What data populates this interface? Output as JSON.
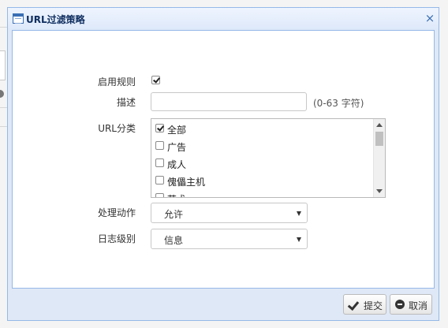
{
  "dialog": {
    "title": "URL过滤策略",
    "close_glyph": "×"
  },
  "form": {
    "enable_rule": {
      "label": "启用规则",
      "checked": true
    },
    "description": {
      "label": "描述",
      "value": "",
      "hint": "(0-63 字符)"
    },
    "url_category": {
      "label": "URL分类",
      "items": [
        {
          "label": "全部",
          "checked": true
        },
        {
          "label": "广告",
          "checked": false
        },
        {
          "label": "成人",
          "checked": false
        },
        {
          "label": "傀儡主机",
          "checked": false
        },
        {
          "label": "艺术",
          "checked": false
        }
      ]
    },
    "action": {
      "label": "处理动作",
      "selected": "允许"
    },
    "log_level": {
      "label": "日志级别",
      "selected": "信息"
    }
  },
  "footer": {
    "submit_label": "提交",
    "cancel_label": "取消"
  },
  "colors": {
    "title_text": "#0e2d5f",
    "dialog_border": "#95b8e7",
    "accent": "#3b6fb4"
  }
}
